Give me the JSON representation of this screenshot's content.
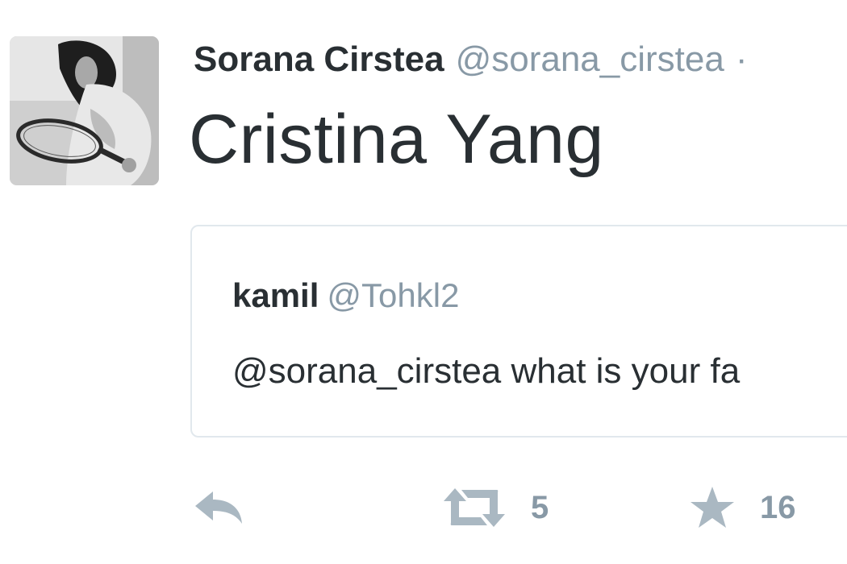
{
  "tweet": {
    "author_name": "Sorana Cirstea",
    "author_handle": "@sorana_cirstea",
    "header_separator": "·",
    "text": "Cristina Yang"
  },
  "quoted_tweet": {
    "author_name": "kamil",
    "author_handle": "@Tohkl2",
    "text": "@sorana_cirstea what is your fa"
  },
  "actions": {
    "reply_icon": "reply-icon",
    "retweet_icon": "retweet-icon",
    "retweet_count": "5",
    "favorite_icon": "star-icon",
    "favorite_count": "16"
  },
  "colors": {
    "text": "#292f33",
    "muted": "#8899a6",
    "icon": "#aab8c2",
    "border": "#e1e8ed"
  }
}
